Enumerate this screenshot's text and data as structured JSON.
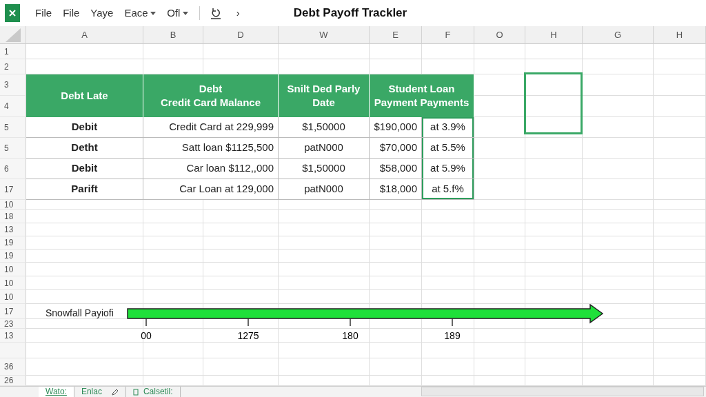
{
  "app_bar": {
    "menu": [
      {
        "label": "File",
        "dropdown": false
      },
      {
        "label": "File",
        "dropdown": false
      },
      {
        "label": "Yaye",
        "dropdown": false
      },
      {
        "label": "Eace",
        "dropdown": true
      },
      {
        "label": "Ofl",
        "dropdown": true
      }
    ],
    "more": "›",
    "title": "Debt Payoff Trackler"
  },
  "columns": [
    "A",
    "B",
    "D",
    "W",
    "E",
    "F",
    "O",
    "H",
    "G",
    "H"
  ],
  "rows": [
    {
      "label": "1"
    },
    {
      "label": "2"
    },
    {
      "label": "3"
    },
    {
      "label": "4"
    },
    {
      "label": "5"
    },
    {
      "label": "5"
    },
    {
      "label": "6"
    },
    {
      "label": "17"
    },
    {
      "label": "10"
    },
    {
      "label": "18"
    },
    {
      "label": "13"
    },
    {
      "label": "19"
    },
    {
      "label": "19"
    },
    {
      "label": "10"
    },
    {
      "label": "10"
    },
    {
      "label": "10"
    },
    {
      "label": "17"
    },
    {
      "label": "23"
    },
    {
      "label": "13"
    },
    {},
    {
      "label": "36"
    },
    {
      "label": "26"
    }
  ],
  "table": {
    "header": [
      {
        "lines": [
          "Debt Late"
        ]
      },
      {
        "lines": [
          "Debt",
          "Credit Card Malance"
        ]
      },
      {
        "lines": [
          "Snilt Ded Parly",
          "Date"
        ]
      },
      {
        "lines": [
          "Student  Loan",
          "Payment Payments"
        ]
      }
    ],
    "rows": [
      [
        {
          "text": "Debit",
          "selected": false
        },
        {
          "text": "Credit Card at 229,999",
          "selected": false
        },
        {
          "text": "$1,50000",
          "selected": false
        },
        {
          "text": "$190,000",
          "selected": false
        },
        {
          "text": "at 3.9%",
          "selected": true
        }
      ],
      [
        {
          "text": "Detht",
          "selected": false
        },
        {
          "text": "Satt loan $1125,500",
          "selected": false
        },
        {
          "text": "patN000",
          "selected": false
        },
        {
          "text": "$70,000",
          "selected": false
        },
        {
          "text": "at 5.5%",
          "selected": true
        }
      ],
      [
        {
          "text": "Debit",
          "selected": false
        },
        {
          "text": "Car loan $112,,000",
          "selected": false
        },
        {
          "text": "$1,50000",
          "selected": false
        },
        {
          "text": "$58,000",
          "selected": false
        },
        {
          "text": "at 5.9%",
          "selected": true
        }
      ],
      [
        {
          "text": "Parift",
          "selected": false
        },
        {
          "text": "Car Loan at 129,000",
          "selected": false
        },
        {
          "text": "patN000",
          "selected": false
        },
        {
          "text": "$18,000",
          "selected": false
        },
        {
          "text": "at 5.f%",
          "selected": true
        }
      ]
    ]
  },
  "timeline": {
    "label": "Snowfall Payiofi",
    "ticks": [
      "00",
      "1275",
      "180",
      "189"
    ]
  },
  "sheet_tabs": [
    {
      "label": "Wato:",
      "selected": true
    },
    {
      "label": "Enlac",
      "selected": false
    },
    {
      "label": "Calsetil:",
      "selected": false
    }
  ]
}
